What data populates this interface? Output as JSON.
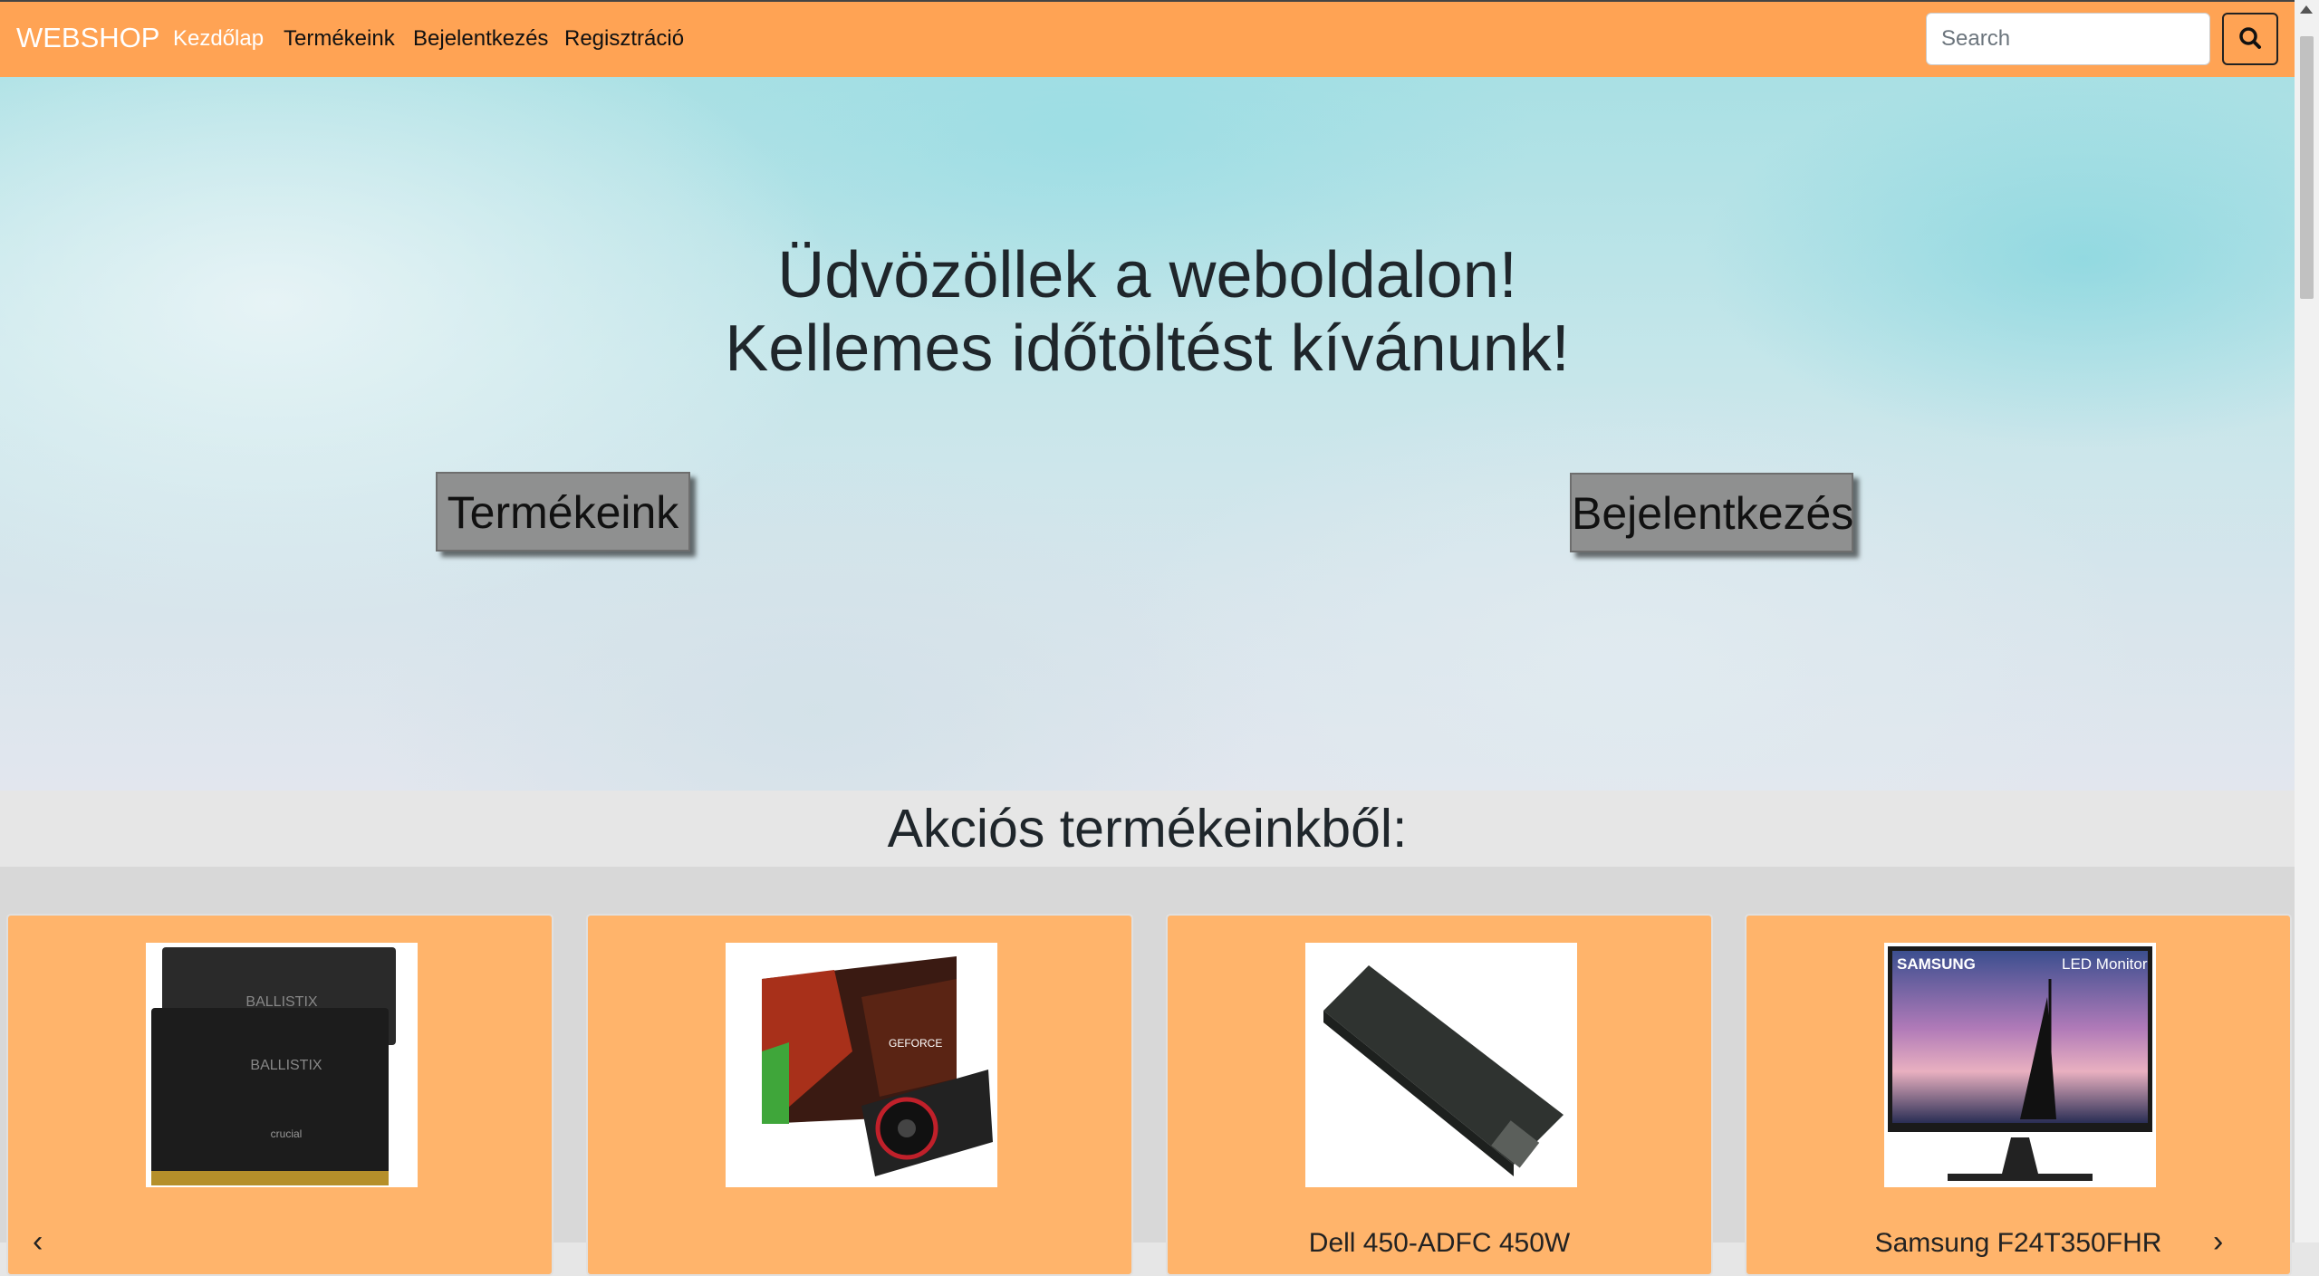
{
  "navbar": {
    "brand": "WEBSHOP",
    "links": [
      "Kezdőlap",
      "Termékeink",
      "Bejelentkezés",
      "Regisztráció"
    ],
    "search_placeholder": "Search",
    "search_icon": "search-icon",
    "colors": {
      "background": "#ffa354",
      "active_link": "#ffffff"
    }
  },
  "hero": {
    "line1": "Üdvözöllek a weboldalon!",
    "line2": "Kellemes időtöltést kívánunk!",
    "button_products": "Termékeink",
    "button_login": "Bejelentkezés"
  },
  "section": {
    "title": "Akciós termékeinkből:"
  },
  "products": [
    {
      "name": "",
      "image": "ram-memory"
    },
    {
      "name": "",
      "image": "graphics-card"
    },
    {
      "name": "Dell 450-ADFC 450W",
      "image": "power-supply"
    },
    {
      "name": "Samsung F24T350FHR",
      "image": "led-monitor",
      "image_text": [
        "SAMSUNG",
        "LED Monitor"
      ]
    }
  ],
  "carousel": {
    "prev_icon": "chevron-left-icon",
    "next_icon": "chevron-right-icon"
  },
  "colors": {
    "card": "#ffb46b",
    "section_bg": "#e6e6e6",
    "button": "#8f9090"
  }
}
